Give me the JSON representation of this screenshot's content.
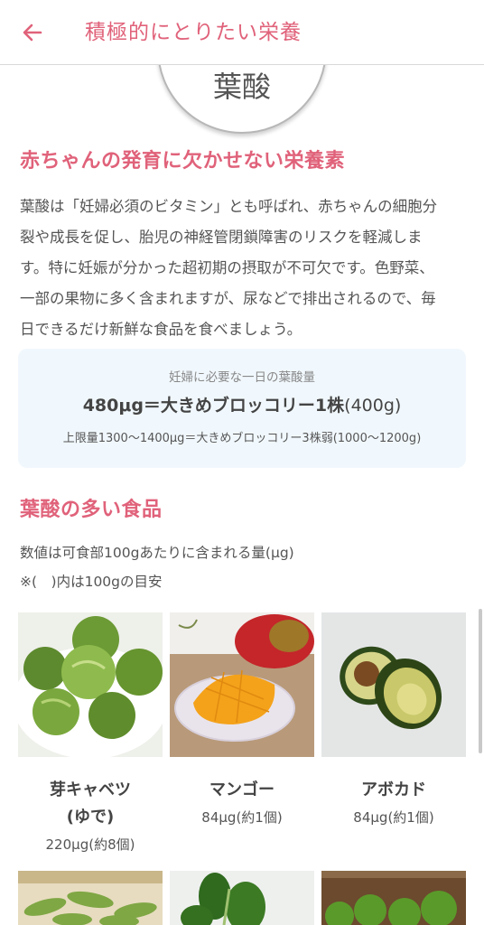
{
  "header": {
    "back_icon": "arrow-left-icon",
    "title": "積極的にとりたい栄養"
  },
  "badge": {
    "label": "葉酸"
  },
  "section1": {
    "heading": "赤ちゃんの発育に欠かせない栄養素",
    "lines": [
      "葉酸は「妊婦必須のビタミン」とも呼ばれ、赤ちゃんの細胞分",
      "裂や成長を促し、胎児の神経管閉鎖障害のリスクを軽減しま",
      "す。特に妊娠が分かった超初期の摂取が不可欠です。色野菜、",
      "一部の果物に多く含まれますが、尿などで排出されるので、毎",
      "日できるだけ新鮮な食品を食べましょう。"
    ]
  },
  "info": {
    "caption": "妊婦に必要な一日の葉酸量",
    "main_bold": "480μg＝大きめブロッコリー1株",
    "main_rest": "(400g)",
    "sub": "上限量1300〜1400μg＝大きめブロッコリー3株弱(1000〜1200g)"
  },
  "section2": {
    "heading": "葉酸の多い食品",
    "note1": "数値は可食部100gあたりに含まれる量(μg)",
    "note2": "※(　)内は100gの目安"
  },
  "foods": [
    {
      "name_line1": "芽キャベツ",
      "name_line2": "(ゆで)",
      "amount": "220μg(約8個)"
    },
    {
      "name_line1": "マンゴー",
      "name_line2": "",
      "amount": "84μg(約1個)"
    },
    {
      "name_line1": "アボカド",
      "name_line2": "",
      "amount": "84μg(約1個)"
    }
  ],
  "colors": {
    "accent": "#e0627a",
    "info_bg": "#f1f8fd"
  }
}
